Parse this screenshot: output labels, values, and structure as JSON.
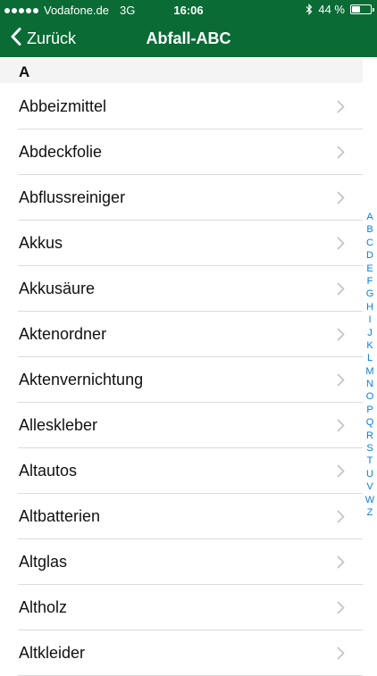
{
  "status_bar": {
    "carrier": "Vodafone.de",
    "network": "3G",
    "time": "16:06",
    "battery_percent_label": "44 %",
    "battery_level": 0.44
  },
  "nav": {
    "back_label": "Zurück",
    "title": "Abfall-ABC"
  },
  "section": {
    "header": "A"
  },
  "items": [
    "Abbeizmittel",
    "Abdeckfolie",
    "Abflussreiniger",
    "Akkus",
    "Akkusäure",
    "Aktenordner",
    "Aktenvernichtung",
    "Alleskleber",
    "Altautos",
    "Altbatterien",
    "Altglas",
    "Altholz",
    "Altkleider"
  ],
  "index_letters": [
    "A",
    "B",
    "C",
    "D",
    "E",
    "F",
    "G",
    "H",
    "I",
    "J",
    "K",
    "L",
    "M",
    "N",
    "O",
    "P",
    "Q",
    "R",
    "S",
    "T",
    "U",
    "V",
    "W",
    "Z"
  ],
  "colors": {
    "header_green": "#0a6b35",
    "index_blue": "#0a7de0"
  }
}
